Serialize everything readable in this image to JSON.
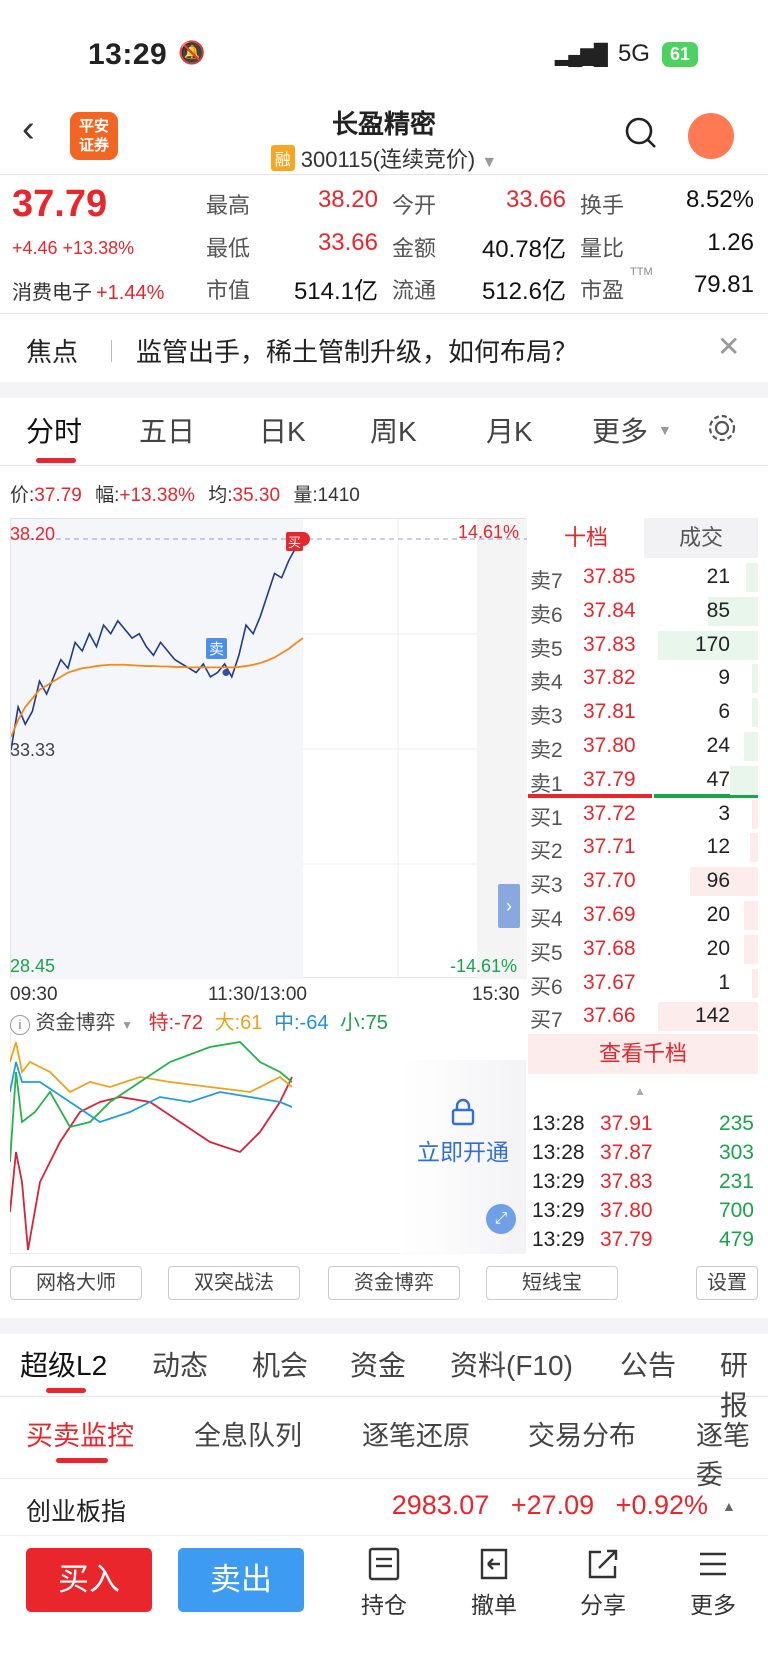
{
  "status": {
    "time": "13:29",
    "network": "5G",
    "battery": "61"
  },
  "header": {
    "title": "长盈精密",
    "rong_badge": "融",
    "code": "300115(连续竞价)",
    "logo_line1": "平安",
    "logo_line2": "证券"
  },
  "quote": {
    "price": "37.79",
    "change": "+4.46 +13.38%",
    "sector_name": "消费电子",
    "sector_change": "+1.44%",
    "rows": [
      [
        {
          "label": "最高",
          "value": "38.20",
          "color": "red"
        },
        {
          "label": "今开",
          "value": "33.66",
          "color": "red"
        },
        {
          "label": "换手",
          "value": "8.52%",
          "color": "black"
        }
      ],
      [
        {
          "label": "最低",
          "value": "33.66",
          "color": "red"
        },
        {
          "label": "金额",
          "value": "40.78亿",
          "color": "black"
        },
        {
          "label": "量比",
          "value": "1.26",
          "color": "black"
        }
      ],
      [
        {
          "label": "市值",
          "value": "514.1亿",
          "color": "black"
        },
        {
          "label": "流通",
          "value": "512.6亿",
          "color": "black"
        },
        {
          "label": "市盈",
          "value": "79.81",
          "color": "black"
        }
      ]
    ],
    "ttm": "TTM"
  },
  "focus": {
    "title": "焦点",
    "text": "监管出手，稀土管制升级，如何布局？"
  },
  "tabs": [
    "分时",
    "五日",
    "日K",
    "周K",
    "月K",
    "更多"
  ],
  "info_line": {
    "price_label": "价:",
    "price": "37.79",
    "amp_label": "幅:",
    "amp": "+13.38%",
    "avg_label": "均:",
    "avg": "35.30",
    "vol_label": "量:",
    "vol": "1410"
  },
  "chart_data": {
    "type": "line",
    "y_top": "38.20",
    "y_mid": "33.33",
    "y_bottom": "28.45",
    "pct_top": "14.61%",
    "pct_bottom": "-14.61%",
    "ylim": [
      28.45,
      38.2
    ],
    "x_labels": [
      "09:30",
      "11:30/13:00",
      "15:30"
    ],
    "series": [
      {
        "name": "价格",
        "values": [
          33.3,
          34.3,
          33.9,
          34.2,
          34.9,
          34.6,
          35.0,
          35.4,
          35.2,
          35.8,
          35.6,
          36.0,
          35.7,
          36.2,
          36.0,
          36.3,
          36.1,
          35.9,
          36.0,
          35.7,
          35.5,
          35.8,
          35.6,
          35.4,
          35.3,
          35.2,
          35.1,
          35.3,
          35.0,
          35.1,
          35.3,
          35.0,
          35.5,
          36.2,
          36.0,
          36.4,
          36.9,
          37.4,
          37.3,
          37.7,
          38.0,
          38.2
        ]
      },
      {
        "name": "均价",
        "values": [
          33.6,
          34.0,
          34.3,
          34.5,
          34.7,
          34.8,
          34.9,
          35.0,
          35.1,
          35.15,
          35.2,
          35.22,
          35.25,
          35.27,
          35.28,
          35.28,
          35.28,
          35.27,
          35.26,
          35.25,
          35.25,
          35.24,
          35.24,
          35.23,
          35.23,
          35.22,
          35.22,
          35.22,
          35.22,
          35.22,
          35.22,
          35.22,
          35.23,
          35.25,
          35.28,
          35.32,
          35.38,
          35.45,
          35.55,
          35.65,
          35.78,
          35.9
        ]
      }
    ],
    "sell_marker": "卖",
    "buy_marker": "买"
  },
  "orderbook": {
    "tab_ten": "十档",
    "tab_trades": "成交",
    "sells": [
      {
        "label": "卖7",
        "price": "37.85",
        "vol": "21",
        "bar": 0.12
      },
      {
        "label": "卖6",
        "price": "37.84",
        "vol": "85",
        "bar": 0.5
      },
      {
        "label": "卖5",
        "price": "37.83",
        "vol": "170",
        "bar": 1.0
      },
      {
        "label": "卖4",
        "price": "37.82",
        "vol": "9",
        "bar": 0.05
      },
      {
        "label": "卖3",
        "price": "37.81",
        "vol": "6",
        "bar": 0.03
      },
      {
        "label": "卖2",
        "price": "37.80",
        "vol": "24",
        "bar": 0.14
      },
      {
        "label": "卖1",
        "price": "37.79",
        "vol": "47",
        "bar": 0.28
      }
    ],
    "buys": [
      {
        "label": "买1",
        "price": "37.72",
        "vol": "3",
        "bar": 0.02
      },
      {
        "label": "买2",
        "price": "37.71",
        "vol": "12",
        "bar": 0.08
      },
      {
        "label": "买3",
        "price": "37.70",
        "vol": "96",
        "bar": 0.68
      },
      {
        "label": "买4",
        "price": "37.69",
        "vol": "20",
        "bar": 0.14
      },
      {
        "label": "买5",
        "price": "37.68",
        "vol": "20",
        "bar": 0.14
      },
      {
        "label": "买6",
        "price": "37.67",
        "vol": "1",
        "bar": 0.01
      },
      {
        "label": "买7",
        "price": "37.66",
        "vol": "142",
        "bar": 1.0
      }
    ],
    "view_1000": "查看千档",
    "trades": [
      {
        "time": "13:28",
        "price": "37.91",
        "vol": "235"
      },
      {
        "time": "13:28",
        "price": "37.87",
        "vol": "303"
      },
      {
        "time": "13:29",
        "price": "37.83",
        "vol": "231"
      },
      {
        "time": "13:29",
        "price": "37.80",
        "vol": "700"
      },
      {
        "time": "13:29",
        "price": "37.79",
        "vol": "479"
      }
    ]
  },
  "indicator": {
    "name": "资金博弈",
    "te": "特:-72",
    "da": "大:61",
    "zhong": "中:-64",
    "xiao": "小:75",
    "unlock": "立即开通"
  },
  "tools": [
    "网格大师",
    "双突战法",
    "资金博弈",
    "短线宝",
    "设置"
  ],
  "section_tabs": [
    "超级L2",
    "动态",
    "机会",
    "资金",
    "资料(F10)",
    "公告",
    "研报"
  ],
  "sub_tabs": [
    "买卖监控",
    "全息队列",
    "逐笔还原",
    "交易分布",
    "逐笔委"
  ],
  "index": {
    "name": "创业板指",
    "value": "2983.07",
    "change": "+27.09",
    "pct": "+0.92%"
  },
  "bottom": {
    "buy": "买入",
    "sell": "卖出",
    "nav": [
      "持仓",
      "撤单",
      "分享",
      "更多"
    ]
  },
  "colors": {
    "up": "#e8262c",
    "down": "#1aa34a",
    "price_line": "#1f3a8a",
    "avg_line": "#f08a1c"
  }
}
